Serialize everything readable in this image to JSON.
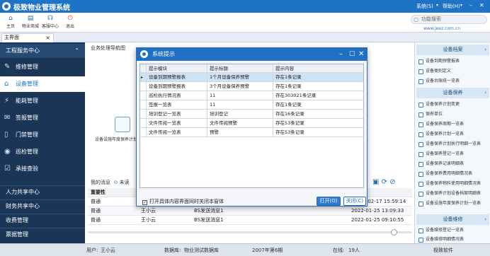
{
  "app": {
    "title": "极致物业管理系统",
    "system_menu": "系统(S)",
    "help_menu": "帮助(H)"
  },
  "toolbar": {
    "items": [
      {
        "label": "主页",
        "icon": "home-icon"
      },
      {
        "label": "物业商城",
        "icon": "shop-icon"
      },
      {
        "label": "客服中心",
        "icon": "headset-icon"
      },
      {
        "label": "退出",
        "icon": "power-icon"
      }
    ],
    "search_placeholder": "功能搜索",
    "website": "www.jeez.com.cn"
  },
  "tabs": [
    {
      "label": "主界面"
    }
  ],
  "sidebar": {
    "section": "工程服务中心",
    "items": [
      {
        "label": "维修管理",
        "icon": "wrench-icon"
      },
      {
        "label": "设备管理",
        "icon": "equipment-icon",
        "active": true
      },
      {
        "label": "能耗管理",
        "icon": "energy-icon"
      },
      {
        "label": "签报管理",
        "icon": "report-icon"
      },
      {
        "label": "门禁管理",
        "icon": "door-icon"
      },
      {
        "label": "巡检管理",
        "icon": "location-icon"
      },
      {
        "label": "承接查验",
        "icon": "inspect-icon"
      }
    ],
    "footer_items": [
      {
        "label": "人力共享中心"
      },
      {
        "label": "财务共享中心"
      },
      {
        "label": "收费管理"
      },
      {
        "label": "票据管理"
      }
    ]
  },
  "main": {
    "flow_title": "业务处理导航图",
    "flow_items": [
      {
        "label": "设备设施年度保养计划"
      }
    ],
    "messages_title": "我的消息",
    "messages_unread": "未读",
    "messages_columns": [
      "重要性",
      "",
      "",
      "时间"
    ],
    "messages": [
      {
        "importance": "普通",
        "sender": "",
        "subject": "",
        "time": "2022-02-17 15:59:14"
      },
      {
        "importance": "普通",
        "sender": "王小云",
        "subject": "BS发送消息1",
        "time": "2022-01-25 13:09:33"
      },
      {
        "importance": "普通",
        "sender": "王小云",
        "subject": "BS发送消息1",
        "time": "2022-01-25 09:10:55"
      }
    ]
  },
  "right_panel": {
    "sections": [
      {
        "title": "设备档案",
        "items": [
          "设备到期预警报表",
          "设备类别定义",
          "设备台账统一览表"
        ]
      },
      {
        "title": "设备保养",
        "items": [
          "设备保养计划变更",
          "保养单位",
          "设备保养周期一览表",
          "设备保养计划一览表",
          "设备保养计划执行明细一览表",
          "设备保养登记一览表",
          "设备保养记录明细表",
          "设备保养费用明细情况表",
          "设备保养物料使用明细情况表",
          "设备保养计划设备档案明细表",
          "设备设施年度保养计划一览表"
        ]
      },
      {
        "title": "设备维修",
        "items": [
          "设备维修登记一览表",
          "设备维修明细情况表"
        ]
      }
    ]
  },
  "status_bar": {
    "user_label": "用户:",
    "user": "王小云",
    "db_label": "数据库:",
    "db": "物业测试数据库",
    "period": "2007年第6期",
    "online_label": "在线:",
    "online": "19人",
    "brand": "极致软件"
  },
  "dialog": {
    "title": "系统提示",
    "columns": [
      "提示模块",
      "提示标题",
      "提示内容"
    ],
    "rows": [
      {
        "module": "设备到期预警报表",
        "title": "1个月设备保养预警",
        "content": "存在1条记录"
      },
      {
        "module": "设备到期预警报表",
        "title": "3个月设备保养预警",
        "content": "存在1条记录"
      },
      {
        "module": "巡检执行情况表",
        "title": "11",
        "content": "存在303021条记录"
      },
      {
        "module": "签报一览表",
        "title": "11",
        "content": "存在1条记录"
      },
      {
        "module": "培训登记一览表",
        "title": "培训登记",
        "content": "存在16条记录"
      },
      {
        "module": "文件传阅一览表",
        "title": "文件传阅预警",
        "content": "存在53条记录"
      },
      {
        "module": "文件传阅一览表",
        "title": "预警",
        "content": "存在53条记录"
      }
    ],
    "checkbox_label": "打开具体内容界面同时关闭本窗体",
    "checkbox_checked": true,
    "open_button": "打开(O)",
    "close_button": "关闭(C)"
  },
  "colors": {
    "brand": "#1e73c6",
    "sidebar": "#1a3556"
  }
}
